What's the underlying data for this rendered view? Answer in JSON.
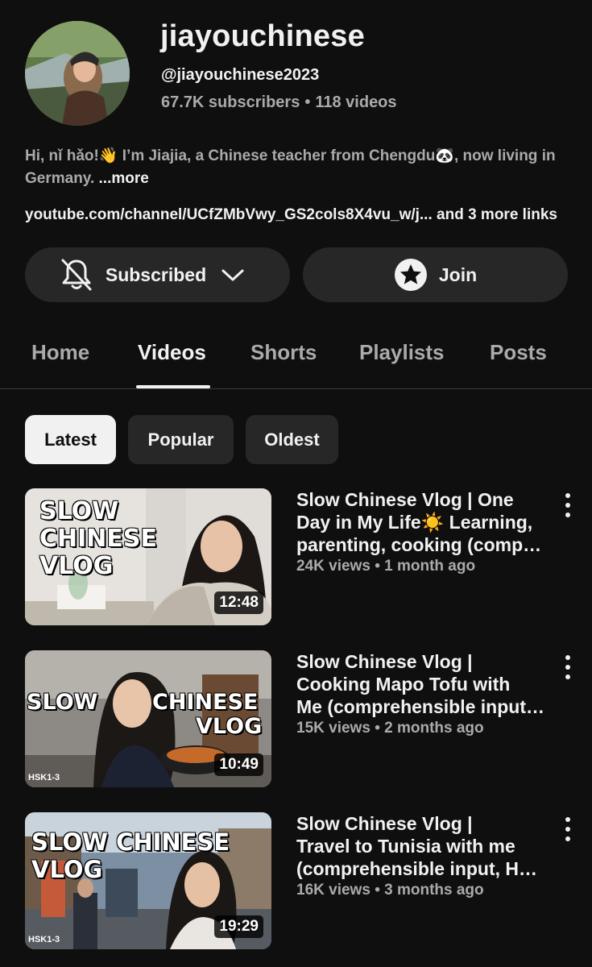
{
  "channel": {
    "name": "jiayouchinese",
    "handle": "@jiayouchinese2023",
    "subscribers": "67.7K subscribers",
    "videos": "118 videos",
    "description": "Hi, nǐ hǎo!👋 I’m Jiajia, a Chinese teacher from Chengdu🐼, now living in Germany.",
    "more_label": "...more",
    "link_text": "youtube.com/channel/UCfZMbVwy_GS2cols8X4vu_w/j...",
    "more_links": "and 3 more links"
  },
  "actions": {
    "subscribed_label": "Subscribed",
    "join_label": "Join"
  },
  "tabs": [
    {
      "label": "Home",
      "active": false
    },
    {
      "label": "Videos",
      "active": true
    },
    {
      "label": "Shorts",
      "active": false
    },
    {
      "label": "Playlists",
      "active": false
    },
    {
      "label": "Posts",
      "active": false
    }
  ],
  "filters": [
    {
      "label": "Latest",
      "active": true
    },
    {
      "label": "Popular",
      "active": false
    },
    {
      "label": "Oldest",
      "active": false
    }
  ],
  "videos": [
    {
      "title_lines": [
        "Slow Chinese Vlog | One",
        "Day in My Life☀️ Learning,",
        "parenting, cooking (compr…"
      ],
      "views": "24K views",
      "age": "1 month ago",
      "duration": "12:48",
      "thumb_text_lines": [
        "SLOW",
        "CHINESE",
        "VLOG"
      ],
      "thumb_badge": ""
    },
    {
      "title_lines": [
        "Slow Chinese Vlog |",
        "Cooking Mapo Tofu with",
        "Me (comprehensible input,…"
      ],
      "views": "15K views",
      "age": "2 months ago",
      "duration": "10:49",
      "thumb_text_lines": [
        "SLOW",
        "CHINESE",
        "VLOG"
      ],
      "thumb_badge": "HSK1-3"
    },
    {
      "title_lines": [
        "Slow Chinese Vlog |",
        "Travel to Tunisia with me",
        "(comprehensible input, HS…"
      ],
      "views": "16K views",
      "age": "3 months ago",
      "duration": "19:29",
      "thumb_text_lines": [
        "SLOW CHINESE",
        "VLOG"
      ],
      "thumb_badge": "HSK1-3"
    }
  ],
  "separator": "•",
  "colors": {
    "background": "#0f0f0f",
    "surface": "#272727",
    "text_primary": "#f1f1f1",
    "text_secondary": "#aaaaaa"
  },
  "icons": {
    "subscribed": "bell-off-icon",
    "chevron": "chevron-down-icon",
    "join": "star-badge-icon",
    "menu": "more-vert-icon"
  }
}
